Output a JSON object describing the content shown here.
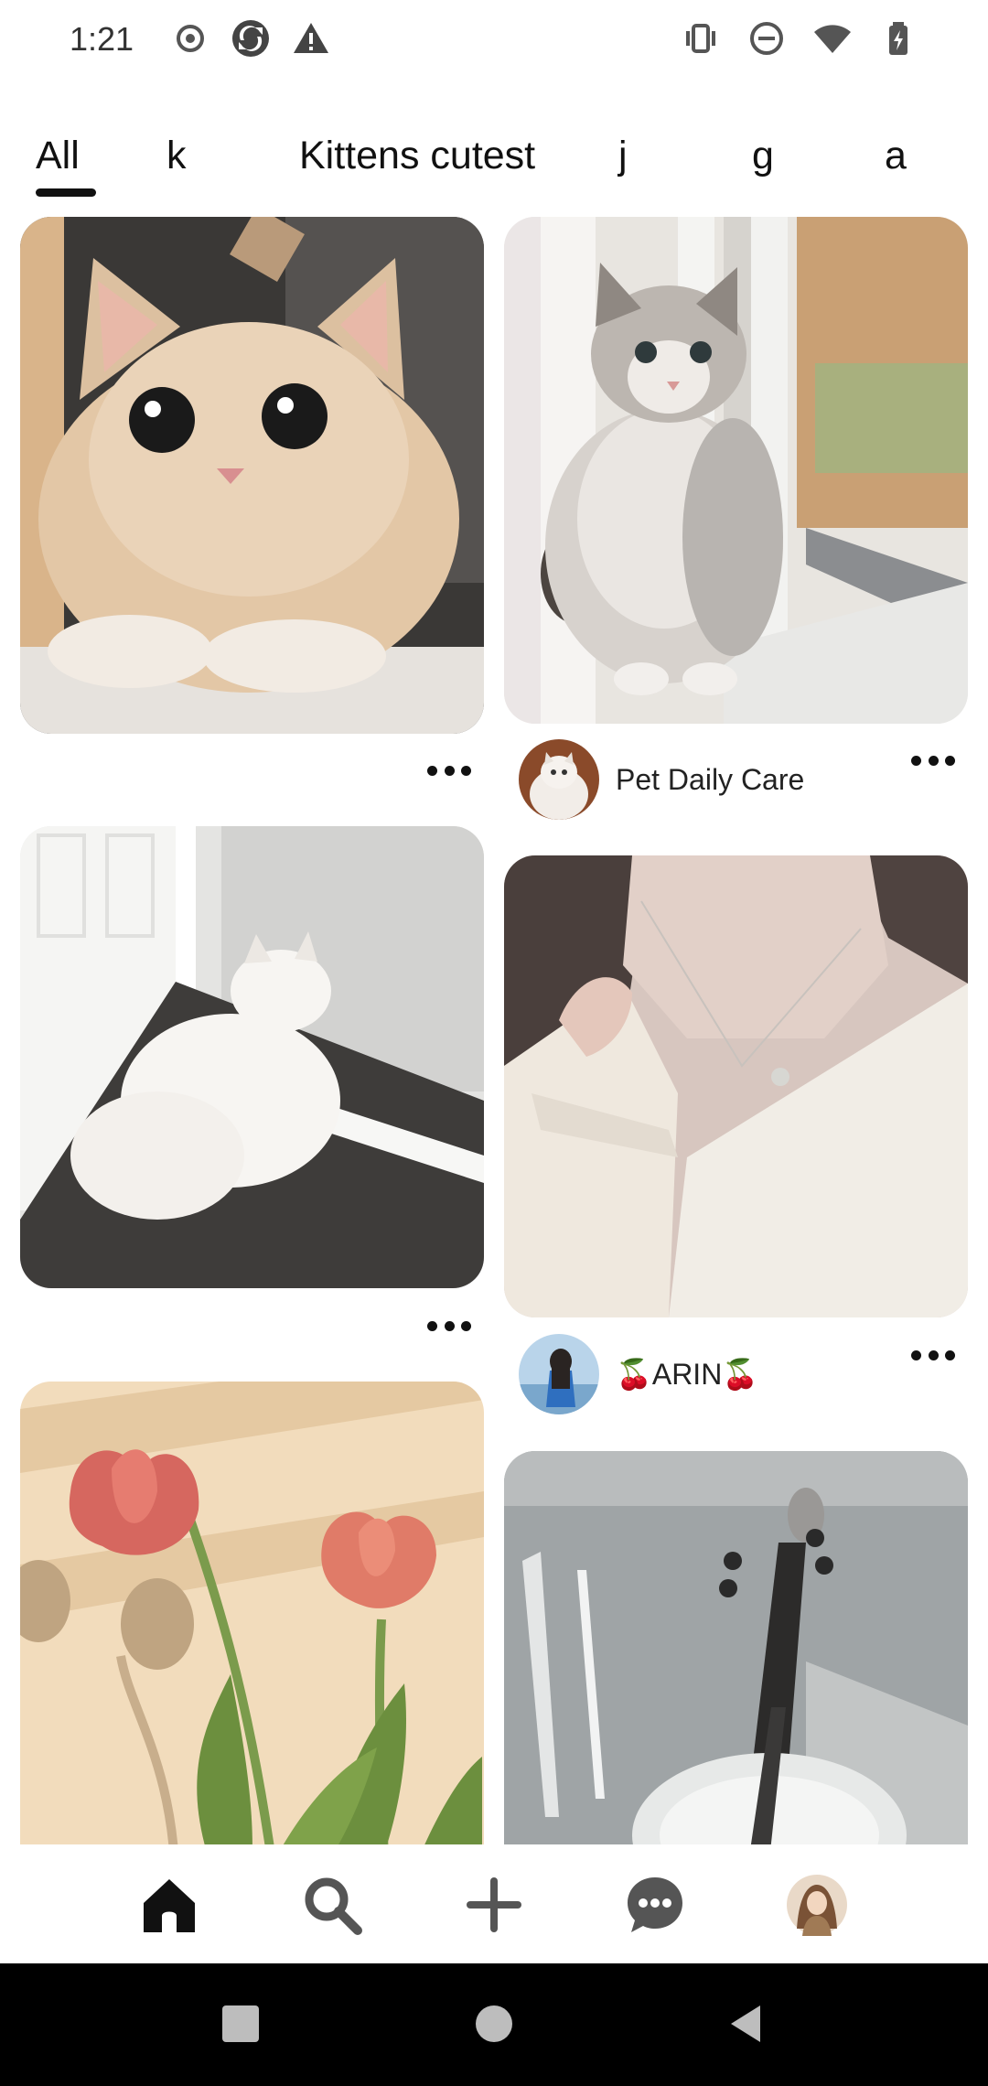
{
  "status_bar": {
    "time": "1:21",
    "left_icons": [
      "record-icon",
      "sync-icon",
      "warning-icon"
    ],
    "right_icons": [
      "vibrate-icon",
      "do-not-disturb-icon",
      "wifi-icon",
      "battery-charging-icon"
    ]
  },
  "tabs": [
    {
      "label": "All",
      "active": true
    },
    {
      "label": "k",
      "active": false
    },
    {
      "label": "Kittens cutest",
      "active": false
    },
    {
      "label": "j",
      "active": false
    },
    {
      "label": "g",
      "active": false
    },
    {
      "label": "a",
      "active": false
    }
  ],
  "feed": {
    "left_column": [
      {
        "image": "cream kitten with big eyes",
        "has_author": false
      },
      {
        "image": "white fluffy cat in hallway",
        "has_author": false
      },
      {
        "image": "red tulips with shadows",
        "has_author": false
      }
    ],
    "right_column": [
      {
        "image": "gray fluffy cat on windowsill",
        "author": "Pet Daily Care"
      },
      {
        "image": "woman with pendant necklace",
        "author": "🍒ARIN🍒"
      },
      {
        "image": "violin in soft light",
        "has_author": false
      }
    ]
  },
  "bottom_nav": {
    "items": [
      "home-icon",
      "search-icon",
      "create-icon",
      "messages-icon",
      "profile-avatar"
    ],
    "active": "home-icon"
  },
  "system_nav": {
    "buttons": [
      "recents-button",
      "home-button",
      "back-button"
    ]
  },
  "colors": {
    "text": "#111111",
    "background": "#ffffff",
    "system_bar": "#000000"
  }
}
